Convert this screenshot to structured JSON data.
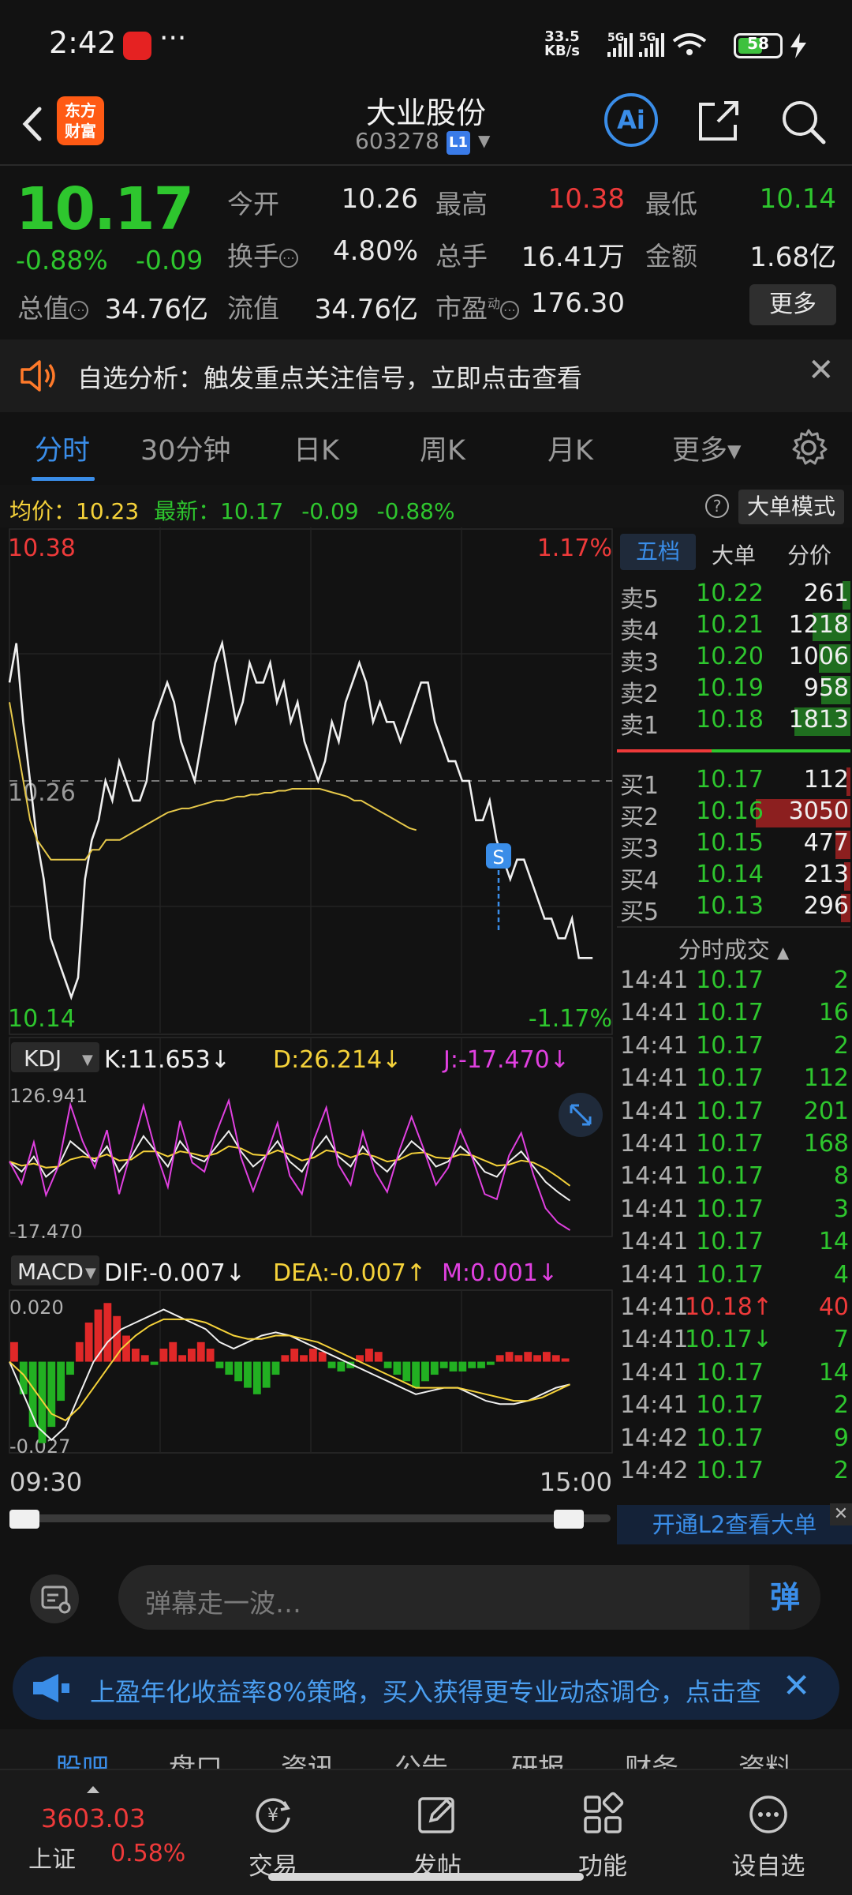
{
  "status_bar": {
    "time": "2:42",
    "more": "···",
    "speed_value": "33.5",
    "speed_unit": "KB/s",
    "battery": "58",
    "network_1": "5G",
    "network_2": "5G"
  },
  "header": {
    "logo_text_1": "东方",
    "logo_text_2": "财富",
    "stock_name": "大业股份",
    "stock_code": "603278",
    "level_badge": "L1",
    "ai_label": "Ai"
  },
  "quote": {
    "price": "10.17",
    "change_pct": "-0.88%",
    "change_abs": "-0.09",
    "open_label": "今开",
    "open": "10.26",
    "high_label": "最高",
    "high": "10.38",
    "low_label": "最低",
    "low": "10.14",
    "turnover_label": "换手",
    "turnover": "4.80%",
    "volume_label": "总手",
    "volume": "16.41万",
    "amount_label": "金额",
    "amount": "1.68亿",
    "mktcap_label": "总值",
    "mktcap": "34.76亿",
    "float_label": "流值",
    "float_cap": "34.76亿",
    "pe_label": "市盈",
    "pe_sup": "动",
    "pe": "176.30",
    "more_button": "更多"
  },
  "alert": {
    "text": "自选分析：触发重点关注信号，立即点击查看"
  },
  "period_tabs": [
    "分时",
    "30分钟",
    "日K",
    "周K",
    "月K",
    "更多▾"
  ],
  "avg_row": {
    "avg_label": "均价：",
    "avg_value": "10.23",
    "latest_label": "最新：",
    "latest_value": "10.17",
    "latest_change": "-0.09",
    "latest_pct": "-0.88%",
    "help": "?",
    "bigorder_button": "大单模式"
  },
  "chart_data": [
    {
      "type": "line",
      "name_hint": "intraday",
      "y_top_label": "10.38",
      "y_bottom_label": "10.14",
      "y_ref_label": "10.26",
      "pct_top_label": "1.17%",
      "pct_bottom_label": "-1.17%",
      "ylim": [
        10.14,
        10.38
      ],
      "ref_price": 10.26,
      "x_start_label": "09:30",
      "x_end_label": "15:00",
      "series": [
        {
          "name": "price",
          "color": "#f0f0f0",
          "values": [
            10.31,
            10.33,
            10.29,
            10.26,
            10.23,
            10.21,
            10.18,
            10.17,
            10.16,
            10.15,
            10.16,
            10.21,
            10.23,
            10.24,
            10.26,
            10.25,
            10.27,
            10.26,
            10.25,
            10.25,
            10.26,
            10.29,
            10.3,
            10.31,
            10.3,
            10.28,
            10.27,
            10.26,
            10.28,
            10.3,
            10.32,
            10.33,
            10.31,
            10.29,
            10.3,
            10.32,
            10.31,
            10.31,
            10.32,
            10.3,
            10.31,
            10.29,
            10.3,
            10.28,
            10.27,
            10.26,
            10.27,
            10.29,
            10.28,
            10.3,
            10.31,
            10.32,
            10.31,
            10.29,
            10.3,
            10.29,
            10.29,
            10.28,
            10.29,
            10.3,
            10.31,
            10.31,
            10.29,
            10.28,
            10.27,
            10.27,
            10.26,
            10.26,
            10.24,
            10.24,
            10.25,
            10.23,
            10.22,
            10.21,
            10.22,
            10.22,
            10.21,
            10.2,
            10.19,
            10.19,
            10.18,
            10.18,
            10.19,
            10.17,
            10.17,
            10.17
          ]
        },
        {
          "name": "avg",
          "color": "#e6c84a",
          "values": [
            10.3,
            10.28,
            10.26,
            10.24,
            10.23,
            10.225,
            10.22,
            10.22,
            10.22,
            10.22,
            10.22,
            10.22,
            10.225,
            10.225,
            10.23,
            10.23,
            10.23,
            10.232,
            10.234,
            10.236,
            10.238,
            10.24,
            10.242,
            10.244,
            10.245,
            10.246,
            10.246,
            10.247,
            10.248,
            10.249,
            10.25,
            10.25,
            10.251,
            10.252,
            10.252,
            10.253,
            10.253,
            10.254,
            10.254,
            10.255,
            10.255,
            10.256,
            10.256,
            10.256,
            10.256,
            10.256,
            10.255,
            10.254,
            10.253,
            10.252,
            10.25,
            10.25,
            10.248,
            10.246,
            10.244,
            10.242,
            10.24,
            10.238,
            10.236,
            10.235
          ]
        }
      ],
      "annotation": "S"
    },
    {
      "type": "line",
      "name_hint": "KDJ",
      "indicator_label": "KDJ",
      "k_label": "K:11.653↓",
      "d_label": "D:26.214↓",
      "j_label": "J:-17.470↓",
      "y_top_label": "126.941",
      "y_bottom_label": "-17.470",
      "ylim": [
        -17.47,
        126.941
      ],
      "series": [
        {
          "name": "K",
          "color": "#f0f0f0",
          "values": [
            50,
            40,
            55,
            35,
            45,
            70,
            60,
            50,
            65,
            40,
            55,
            75,
            60,
            45,
            70,
            55,
            50,
            65,
            80,
            60,
            45,
            55,
            70,
            50,
            40,
            60,
            75,
            55,
            45,
            65,
            50,
            40,
            55,
            70,
            60,
            45,
            50,
            65,
            55,
            40,
            35,
            50,
            60,
            45,
            30,
            20,
            11.6
          ]
        },
        {
          "name": "D",
          "color": "#f5d23a",
          "values": [
            50,
            46,
            48,
            44,
            45,
            52,
            55,
            53,
            57,
            51,
            52,
            60,
            60,
            55,
            60,
            58,
            55,
            58,
            65,
            63,
            57,
            56,
            61,
            57,
            51,
            54,
            61,
            59,
            54,
            58,
            55,
            50,
            52,
            58,
            59,
            54,
            53,
            57,
            56,
            51,
            46,
            47,
            51,
            49,
            43,
            35,
            26.2
          ]
        },
        {
          "name": "J",
          "color": "#e040e0",
          "values": [
            50,
            28,
            69,
            17,
            45,
            106,
            70,
            44,
            81,
            18,
            61,
            105,
            60,
            25,
            90,
            49,
            40,
            79,
            110,
            54,
            21,
            53,
            88,
            36,
            18,
            72,
            103,
            47,
            27,
            79,
            40,
            20,
            61,
            94,
            62,
            27,
            44,
            81,
            53,
            18,
            13,
            56,
            78,
            37,
            4,
            -10,
            -17.47
          ]
        }
      ]
    },
    {
      "type": "bar",
      "name_hint": "MACD",
      "indicator_label": "MACD",
      "dif_label": "DIF:-0.007↓",
      "dea_label": "DEA:-0.007↑",
      "m_label": "M:0.001↓",
      "y_top_label": "0.020",
      "y_bottom_label": "-0.027",
      "ylim": [
        -0.027,
        0.02
      ],
      "series": [
        {
          "name": "M",
          "values": [
            0.006,
            -0.01,
            -0.02,
            -0.025,
            -0.02,
            -0.012,
            -0.004,
            0.006,
            0.012,
            0.016,
            0.018,
            0.014,
            0.008,
            0.004,
            0.002,
            -0.001,
            0.004,
            0.006,
            0.002,
            0.004,
            0.006,
            0.004,
            -0.002,
            -0.004,
            -0.006,
            -0.008,
            -0.01,
            -0.008,
            -0.004,
            0.002,
            0.004,
            0.002,
            0.004,
            0.003,
            -0.002,
            -0.003,
            -0.002,
            0.002,
            0.004,
            0.003,
            -0.002,
            -0.004,
            -0.006,
            -0.008,
            -0.006,
            -0.004,
            -0.002,
            -0.003,
            -0.003,
            -0.002,
            -0.002,
            -0.001,
            0.002,
            0.003,
            0.002,
            0.003,
            0.002,
            0.003,
            0.002,
            0.001
          ]
        },
        {
          "name": "DIF",
          "color": "#f0f0f0",
          "values": [
            0.0,
            -0.01,
            -0.02,
            -0.024,
            -0.02,
            -0.01,
            0.0,
            0.006,
            0.01,
            0.012,
            0.014,
            0.016,
            0.014,
            0.012,
            0.01,
            0.006,
            0.004,
            0.006,
            0.008,
            0.009,
            0.008,
            0.006,
            0.004,
            0.002,
            0.0,
            -0.002,
            -0.004,
            -0.006,
            -0.008,
            -0.01,
            -0.009,
            -0.008,
            -0.008,
            -0.01,
            -0.012,
            -0.013,
            -0.013,
            -0.012,
            -0.01,
            -0.008,
            -0.007
          ]
        },
        {
          "name": "DEA",
          "color": "#f5d23a",
          "values": [
            0.0,
            -0.004,
            -0.01,
            -0.016,
            -0.018,
            -0.014,
            -0.008,
            -0.002,
            0.004,
            0.008,
            0.011,
            0.013,
            0.013,
            0.013,
            0.012,
            0.01,
            0.008,
            0.007,
            0.007,
            0.008,
            0.008,
            0.007,
            0.006,
            0.004,
            0.002,
            0.0,
            -0.002,
            -0.004,
            -0.006,
            -0.008,
            -0.008,
            -0.008,
            -0.008,
            -0.009,
            -0.01,
            -0.011,
            -0.012,
            -0.012,
            -0.011,
            -0.009,
            -0.007
          ]
        }
      ]
    }
  ],
  "order_book": {
    "tabs": [
      "五档",
      "大单",
      "分价"
    ],
    "sells": [
      {
        "label": "卖5",
        "price": "10.22",
        "vol": "261",
        "bar": 0.08
      },
      {
        "label": "卖4",
        "price": "10.21",
        "vol": "1218",
        "bar": 0.4
      },
      {
        "label": "卖3",
        "price": "10.20",
        "vol": "1006",
        "bar": 0.33
      },
      {
        "label": "卖2",
        "price": "10.19",
        "vol": "958",
        "bar": 0.31
      },
      {
        "label": "卖1",
        "price": "10.18",
        "vol": "1813",
        "bar": 0.59
      }
    ],
    "buys": [
      {
        "label": "买1",
        "price": "10.17",
        "vol": "112",
        "bar": 0.04
      },
      {
        "label": "买2",
        "price": "10.16",
        "vol": "3050",
        "bar": 1.0
      },
      {
        "label": "买3",
        "price": "10.15",
        "vol": "477",
        "bar": 0.16
      },
      {
        "label": "买4",
        "price": "10.14",
        "vol": "213",
        "bar": 0.07
      },
      {
        "label": "买5",
        "price": "10.13",
        "vol": "296",
        "bar": 0.1
      }
    ],
    "ticks_title": "分时成交",
    "ticks": [
      {
        "time": "14:41",
        "price": "10.17",
        "vol": "2",
        "color": "green"
      },
      {
        "time": "14:41",
        "price": "10.17",
        "vol": "16",
        "color": "green"
      },
      {
        "time": "14:41",
        "price": "10.17",
        "vol": "2",
        "color": "green"
      },
      {
        "time": "14:41",
        "price": "10.17",
        "vol": "112",
        "color": "green"
      },
      {
        "time": "14:41",
        "price": "10.17",
        "vol": "201",
        "color": "green"
      },
      {
        "time": "14:41",
        "price": "10.17",
        "vol": "168",
        "color": "green"
      },
      {
        "time": "14:41",
        "price": "10.17",
        "vol": "8",
        "color": "green"
      },
      {
        "time": "14:41",
        "price": "10.17",
        "vol": "3",
        "color": "green"
      },
      {
        "time": "14:41",
        "price": "10.17",
        "vol": "14",
        "color": "green"
      },
      {
        "time": "14:41",
        "price": "10.17",
        "vol": "4",
        "color": "green"
      },
      {
        "time": "14:41",
        "price": "10.18↑",
        "vol": "40",
        "color": "red"
      },
      {
        "time": "14:41",
        "price": "10.17↓",
        "vol": "7",
        "color": "green"
      },
      {
        "time": "14:41",
        "price": "10.17",
        "vol": "14",
        "color": "green"
      },
      {
        "time": "14:41",
        "price": "10.17",
        "vol": "2",
        "color": "green"
      },
      {
        "time": "14:42",
        "price": "10.17",
        "vol": "9",
        "color": "green"
      },
      {
        "time": "14:42",
        "price": "10.17",
        "vol": "2",
        "color": "green"
      }
    ],
    "l2_promo": "开通L2查看大单"
  },
  "comment": {
    "placeholder": "弹幕走一波…",
    "danmaku_button": "弹"
  },
  "promo": {
    "text": "上盈年化收益率8%策略，买入获得更专业动态调仓，点击查"
  },
  "footer_tabs": [
    "股吧",
    "盘口",
    "资讯",
    "公告",
    "研报",
    "财务",
    "资料"
  ],
  "bottom_nav": {
    "index_value": "3603.03",
    "index_name": "上证",
    "index_pct": "0.58%",
    "items": [
      "交易",
      "发帖",
      "功能",
      "设自选"
    ]
  }
}
